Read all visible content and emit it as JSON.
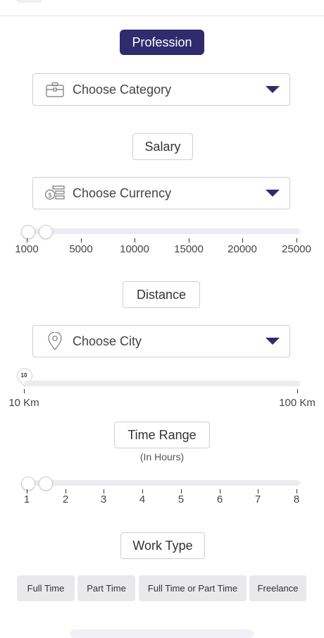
{
  "profession": {
    "button_label": "Profession"
  },
  "category": {
    "placeholder": "Choose Category"
  },
  "salary": {
    "label": "Salary",
    "currency_placeholder": "Choose Currency",
    "ticks": [
      "1000",
      "5000",
      "10000",
      "15000",
      "20000",
      "25000"
    ],
    "range": [
      1000,
      25000
    ],
    "selected_min": 1000,
    "selected_max": 3000
  },
  "distance": {
    "label": "Distance",
    "city_placeholder": "Choose City",
    "value_badge": "10",
    "min_label": "10 Km",
    "max_label": "100 Km",
    "range": [
      10,
      100
    ],
    "selected": 10
  },
  "time_range": {
    "label": "Time Range",
    "sub_label": "(In Hours)",
    "ticks": [
      "1",
      "2",
      "3",
      "4",
      "5",
      "6",
      "7",
      "8"
    ],
    "selected_min": 1,
    "selected_max": 1.5
  },
  "work_type": {
    "label": "Work Type",
    "options": [
      "Full Time",
      "Part Time",
      "Full Time or Part Time",
      "Freelance"
    ]
  },
  "colors": {
    "accent": "#2f2b6d",
    "track": "#ebebf2",
    "border": "#cfcfd6",
    "chip_bg": "#e9e9ec"
  },
  "icons": {
    "category": "briefcase-icon",
    "currency": "money-list-icon",
    "city": "location-pin-icon",
    "dropdown": "caret-down-icon"
  }
}
